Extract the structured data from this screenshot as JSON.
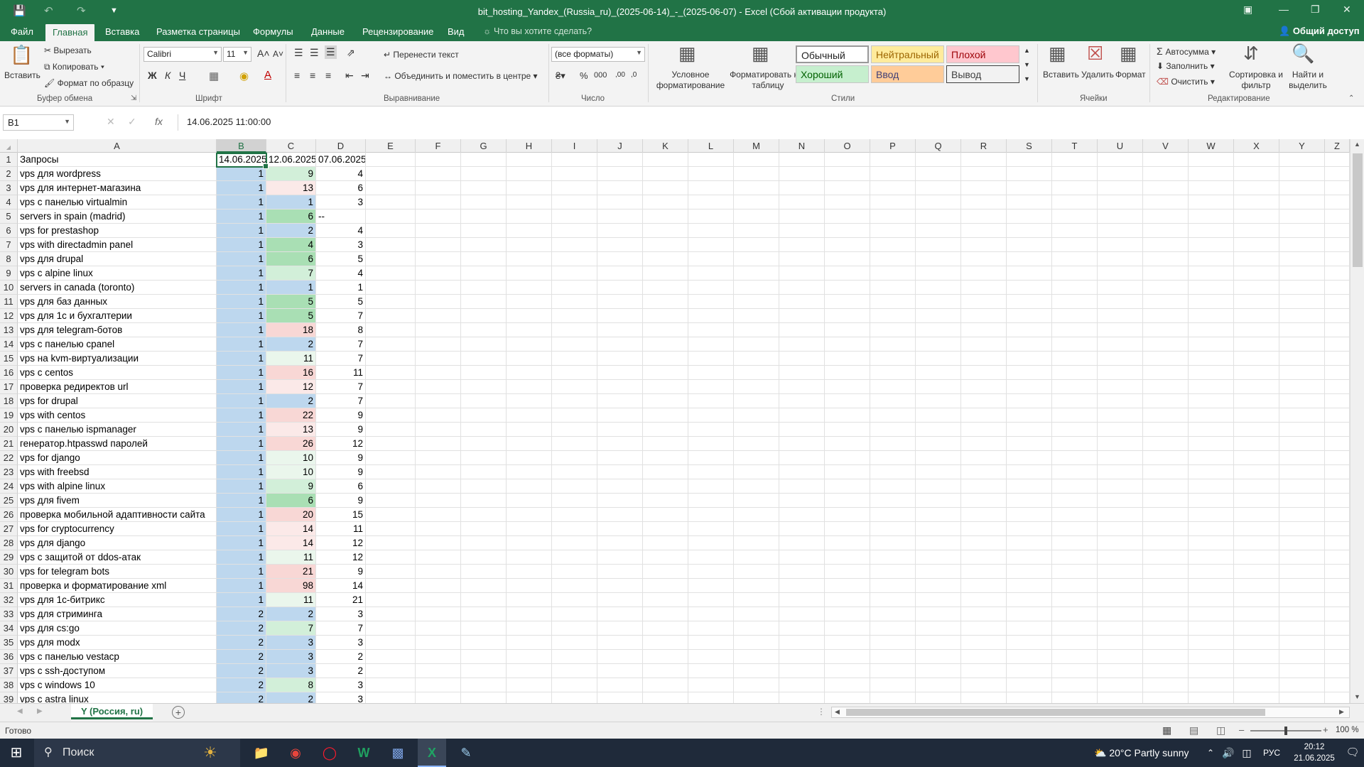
{
  "window": {
    "title": "bit_hosting_Yandex_(Russia_ru)_(2025-06-14)_-_(2025-06-07) - Excel (Сбой активации продукта)"
  },
  "tabs": [
    "Файл",
    "Главная",
    "Вставка",
    "Разметка страницы",
    "Формулы",
    "Данные",
    "Рецензирование",
    "Вид"
  ],
  "tell_me": "Что вы хотите сделать?",
  "share": "Общий доступ",
  "ribbon": {
    "clipboard": {
      "paste": "Вставить",
      "cut": "Вырезать",
      "copy": "Копировать",
      "format_painter": "Формат по образцу",
      "label": "Буфер обмена"
    },
    "font": {
      "name": "Calibri",
      "size": "11",
      "bold": "Ж",
      "italic": "К",
      "underline": "Ч",
      "label": "Шрифт"
    },
    "alignment": {
      "wrap": "Перенести текст",
      "merge": "Объединить и поместить в центре",
      "label": "Выравнивание"
    },
    "number": {
      "format": "(все форматы)",
      "label": "Число"
    },
    "styles": {
      "conditional": "Условное форматирование",
      "as_table": "Форматировать как таблицу",
      "normal": "Обычный",
      "neutral": "Нейтральный",
      "bad": "Плохой",
      "good": "Хороший",
      "input": "Ввод",
      "output": "Вывод",
      "label": "Стили"
    },
    "cells": {
      "insert": "Вставить",
      "delete": "Удалить",
      "format": "Формат",
      "label": "Ячейки"
    },
    "editing": {
      "autosum": "Автосумма",
      "fill": "Заполнить",
      "clear": "Очистить",
      "sort": "Сортировка и фильтр",
      "find": "Найти и выделить",
      "label": "Редактирование"
    }
  },
  "formula_bar": {
    "name_box": "B1",
    "fx": "fx",
    "content": "14.06.2025  11:00:00"
  },
  "columns": [
    "A",
    "B",
    "C",
    "D",
    "E",
    "F",
    "G",
    "H",
    "I",
    "J",
    "K",
    "L",
    "M",
    "N",
    "O",
    "P",
    "Q",
    "R",
    "S",
    "T",
    "U",
    "V",
    "W",
    "X",
    "Y",
    "Z"
  ],
  "header_row": [
    "Запросы",
    "14.06.2025",
    "12.06.2025",
    "07.06.2025"
  ],
  "rows": [
    [
      "vps для wordpress",
      1,
      9,
      4
    ],
    [
      "vps для интернет-магазина",
      1,
      13,
      6
    ],
    [
      "vps с панелью virtualmin",
      1,
      1,
      3
    ],
    [
      "servers in spain (madrid)",
      1,
      6,
      "--"
    ],
    [
      "vps for prestashop",
      1,
      2,
      4
    ],
    [
      "vps with directadmin panel",
      1,
      4,
      3
    ],
    [
      "vps для drupal",
      1,
      6,
      5
    ],
    [
      "vps с alpine linux",
      1,
      7,
      4
    ],
    [
      "servers in canada (toronto)",
      1,
      1,
      1
    ],
    [
      "vps для баз данных",
      1,
      5,
      5
    ],
    [
      "vps для 1с и бухгалтерии",
      1,
      5,
      7
    ],
    [
      "vps для telegram-ботов",
      1,
      18,
      8
    ],
    [
      "vps с панелью cpanel",
      1,
      2,
      7
    ],
    [
      "vps на kvm-виртуализации",
      1,
      11,
      7
    ],
    [
      "vps с centos",
      1,
      16,
      11
    ],
    [
      "проверка редиректов url",
      1,
      12,
      7
    ],
    [
      "vps for drupal",
      1,
      2,
      7
    ],
    [
      "vps with centos",
      1,
      22,
      9
    ],
    [
      "vps с панелью ispmanager",
      1,
      13,
      9
    ],
    [
      "генератор.htpasswd паролей",
      1,
      26,
      12
    ],
    [
      "vps for django",
      1,
      10,
      9
    ],
    [
      "vps with freebsd",
      1,
      10,
      9
    ],
    [
      "vps with alpine linux",
      1,
      9,
      6
    ],
    [
      "vps для fivem",
      1,
      6,
      9
    ],
    [
      "проверка мобильной адаптивности сайта",
      1,
      20,
      15
    ],
    [
      "vps for cryptocurrency",
      1,
      14,
      11
    ],
    [
      "vps для django",
      1,
      14,
      12
    ],
    [
      "vps с защитой от ddos-атак",
      1,
      11,
      12
    ],
    [
      "vps for telegram bots",
      1,
      21,
      9
    ],
    [
      "проверка и форматирование xml",
      1,
      98,
      14
    ],
    [
      "vps для 1с-битрикс",
      1,
      11,
      21
    ],
    [
      "vps для стриминга",
      2,
      2,
      3
    ],
    [
      "vps для cs:go",
      2,
      7,
      7
    ],
    [
      "vps для modx",
      2,
      3,
      3
    ],
    [
      "vps с панелью vestacp",
      2,
      3,
      2
    ],
    [
      "vps с ssh-доступом",
      2,
      3,
      2
    ],
    [
      "vps с windows 10",
      2,
      8,
      3
    ],
    [
      "vps с astra linux",
      2,
      2,
      3
    ]
  ],
  "cell_colors": {
    "blue": "#bdd7ee",
    "green_strong": "#a9dfb4",
    "green_light": "#d2efd9",
    "green_faint": "#eaf6ec",
    "red_light": "#f8d7d5",
    "red_faint": "#fbe9e8"
  },
  "sheet_tab": "Y (Россия, ru)",
  "add_sheet": "+",
  "status": {
    "ready": "Готово",
    "zoom": "100 %"
  },
  "taskbar": {
    "search": "Поиск",
    "weather": "20°C  Partly sunny",
    "lang": "РУС",
    "time": "20:12",
    "date": "21.06.2025"
  }
}
